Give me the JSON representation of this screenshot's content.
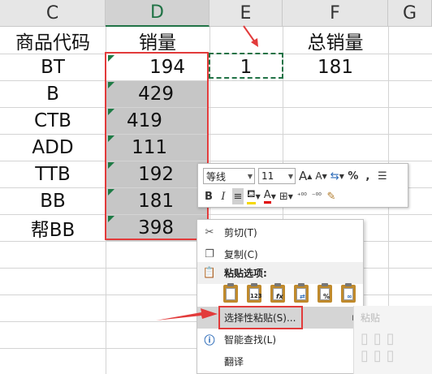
{
  "columns": [
    "C",
    "D",
    "E",
    "F",
    "G"
  ],
  "headers": {
    "c": "商品代码",
    "d": "销量",
    "f": "总销量"
  },
  "rows": [
    {
      "code": "BT",
      "sales": "194"
    },
    {
      "code": "B",
      "sales": "429"
    },
    {
      "code": "CTB",
      "sales": "419"
    },
    {
      "code": "ADD",
      "sales": "111"
    },
    {
      "code": "TTB",
      "sales": "192"
    },
    {
      "code": "BB",
      "sales": "181"
    },
    {
      "code": "帮BB",
      "sales": "398"
    }
  ],
  "e_value": "1",
  "f_value": "181",
  "toolbar": {
    "font_name": "等线",
    "font_size": "11",
    "grow": "A",
    "shrink": "A",
    "percent": "%",
    "comma": ",",
    "bold": "B",
    "italic": "I"
  },
  "menu": {
    "cut": "剪切(T)",
    "copy": "复制(C)",
    "paste_options": "粘贴选项:",
    "paste_special": "选择性粘贴(S)...",
    "smart_lookup": "智能查找(L)",
    "translate": "翻译",
    "submenu_title": "粘贴"
  },
  "colors": {
    "accent": "#217346",
    "annotation": "#e23b3b",
    "highlight": "#d5d5d5"
  }
}
